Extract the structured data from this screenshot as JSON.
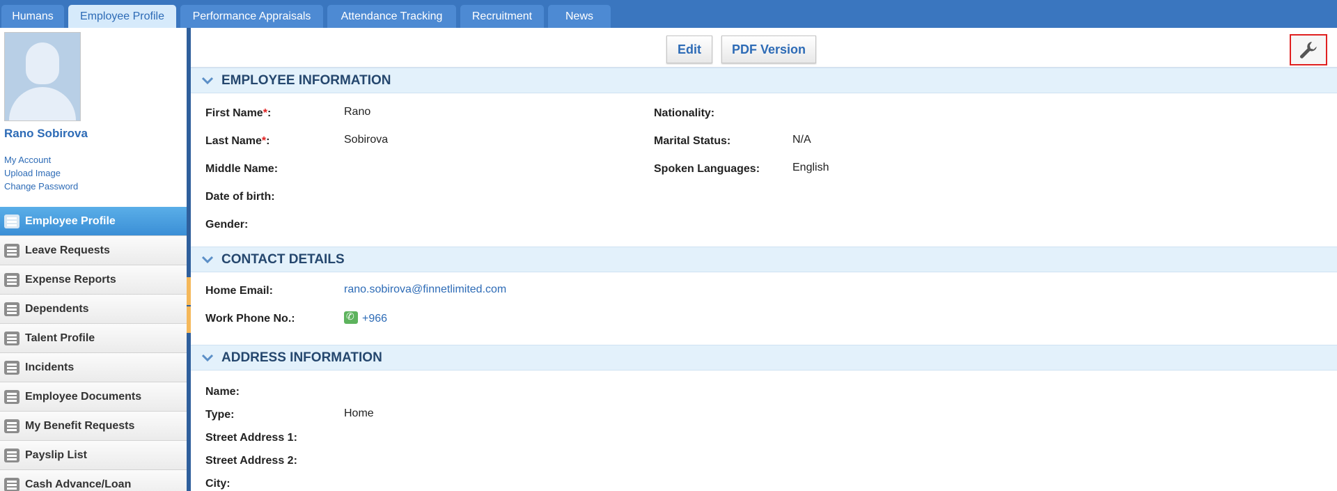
{
  "top_tabs": [
    {
      "label": "Humans"
    },
    {
      "label": "Employee Profile"
    },
    {
      "label": "Performance Appraisals"
    },
    {
      "label": "Attendance Tracking"
    },
    {
      "label": "Recruitment"
    },
    {
      "label": "News"
    }
  ],
  "user": {
    "name": "Rano Sobirova",
    "links": [
      "My Account",
      "Upload Image",
      "Change Password"
    ]
  },
  "menu": [
    {
      "label": "Employee Profile",
      "icon": "profile-icon"
    },
    {
      "label": "Leave Requests",
      "icon": "leave-icon"
    },
    {
      "label": "Expense Reports",
      "icon": "expense-icon"
    },
    {
      "label": "Dependents",
      "icon": "dependents-icon"
    },
    {
      "label": "Talent Profile",
      "icon": "talent-icon"
    },
    {
      "label": "Incidents",
      "icon": "incidents-icon"
    },
    {
      "label": "Employee Documents",
      "icon": "documents-icon"
    },
    {
      "label": "My Benefit Requests",
      "icon": "benefit-icon"
    },
    {
      "label": "Payslip List",
      "icon": "payslip-icon"
    },
    {
      "label": "Cash Advance/Loan",
      "icon": "cash-icon"
    }
  ],
  "toolbar": {
    "edit_label": "Edit",
    "pdf_label": "PDF Version",
    "tools_icon": "wrench-icon"
  },
  "sections": {
    "employee_info": {
      "title": "EMPLOYEE INFORMATION",
      "first_name_label": "First Name",
      "first_name": "Rano",
      "last_name_label": "Last Name",
      "last_name": "Sobirova",
      "middle_name_label": "Middle Name:",
      "dob_label": "Date of birth:",
      "gender_label": "Gender:",
      "nationality_label": "Nationality:",
      "marital_label": "Marital Status:",
      "marital": "N/A",
      "languages_label": "Spoken Languages:",
      "languages": "English"
    },
    "contact": {
      "title": "CONTACT DETAILS",
      "email_label": "Home Email:",
      "email": "rano.sobirova@finnetlimited.com",
      "phone_label": "Work Phone No.:",
      "phone": "+966"
    },
    "address": {
      "title": "ADDRESS INFORMATION",
      "name_label": "Name:",
      "type_label": "Type:",
      "type": "Home",
      "street1_label": "Street Address 1:",
      "street2_label": "Street Address 2:",
      "city_label": "City:"
    }
  },
  "colors": {
    "topbar": "#3a76bf",
    "accent": "#2d6bb6",
    "section_bg": "#e3f1fb",
    "required": "#e02020"
  }
}
